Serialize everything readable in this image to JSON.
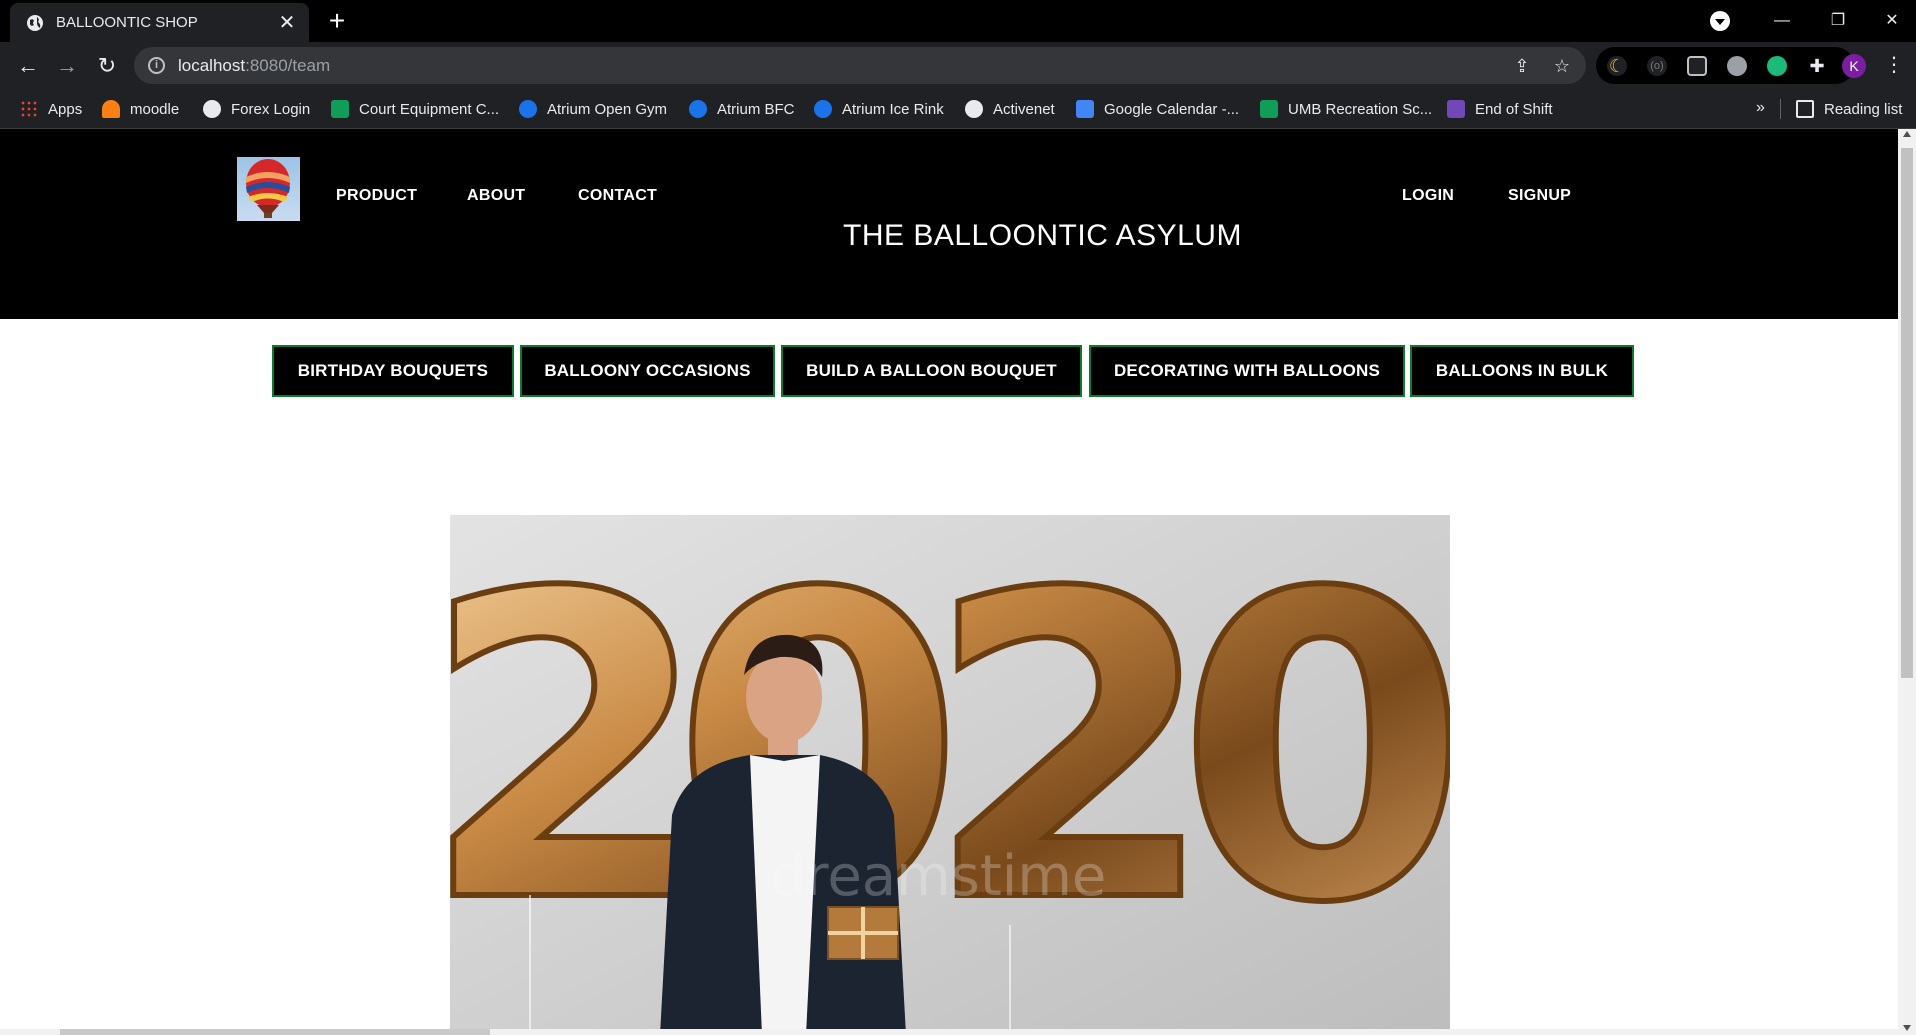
{
  "browser": {
    "tab_title": "BALLOONTIC SHOP",
    "tab_close": "✕",
    "new_tab": "+",
    "url_host": "localhost",
    "url_path": ":8080/team",
    "window_minimize": "—",
    "window_restore": "❐",
    "window_close": "✕",
    "avatar_letter": "K",
    "bookmarks": [
      {
        "label": "Apps",
        "icon": "apps-grid-icon",
        "color": "#ea4335"
      },
      {
        "label": "moodle",
        "icon": "moodle-icon",
        "color": "#f98012"
      },
      {
        "label": "Forex Login",
        "icon": "globe-icon",
        "color": "#e8eaed"
      },
      {
        "label": "Court Equipment C...",
        "icon": "sheets-icon",
        "color": "#0f9d58"
      },
      {
        "label": "Atrium Open Gym",
        "icon": "atrium-icon",
        "color": "#1a73e8"
      },
      {
        "label": "Atrium BFC",
        "icon": "atrium-icon",
        "color": "#1a73e8"
      },
      {
        "label": "Atrium Ice Rink",
        "icon": "atrium-icon",
        "color": "#1a73e8"
      },
      {
        "label": "Activenet",
        "icon": "globe-icon",
        "color": "#e8eaed"
      },
      {
        "label": "Google Calendar -...",
        "icon": "calendar-icon",
        "color": "#4285f4"
      },
      {
        "label": "UMB Recreation Sc...",
        "icon": "sheets-icon",
        "color": "#0f9d58"
      },
      {
        "label": "End of Shift",
        "icon": "forms-icon",
        "color": "#7248b9"
      }
    ],
    "bookmarks_more": "»",
    "reading_list": "Reading list"
  },
  "site": {
    "nav_left": [
      "PRODUCT",
      "ABOUT",
      "CONTACT"
    ],
    "nav_right": [
      "LOGIN",
      "SIGNUP"
    ],
    "title": "THE BALLOONTIC ASYLUM",
    "categories": [
      "BIRTHDAY BOUQUETS",
      "BALLOONY OCCASIONS",
      "BUILD A BALLOON BOUQUET",
      "DECORATING WITH BALLOONS",
      "BALLOONS IN BULK"
    ],
    "hero_numbers": "2020",
    "hero_watermark": "dreamstime"
  },
  "colors": {
    "header_bg": "#000000",
    "category_border": "#0e7a2e",
    "balloon_gold": "#c98a45"
  }
}
